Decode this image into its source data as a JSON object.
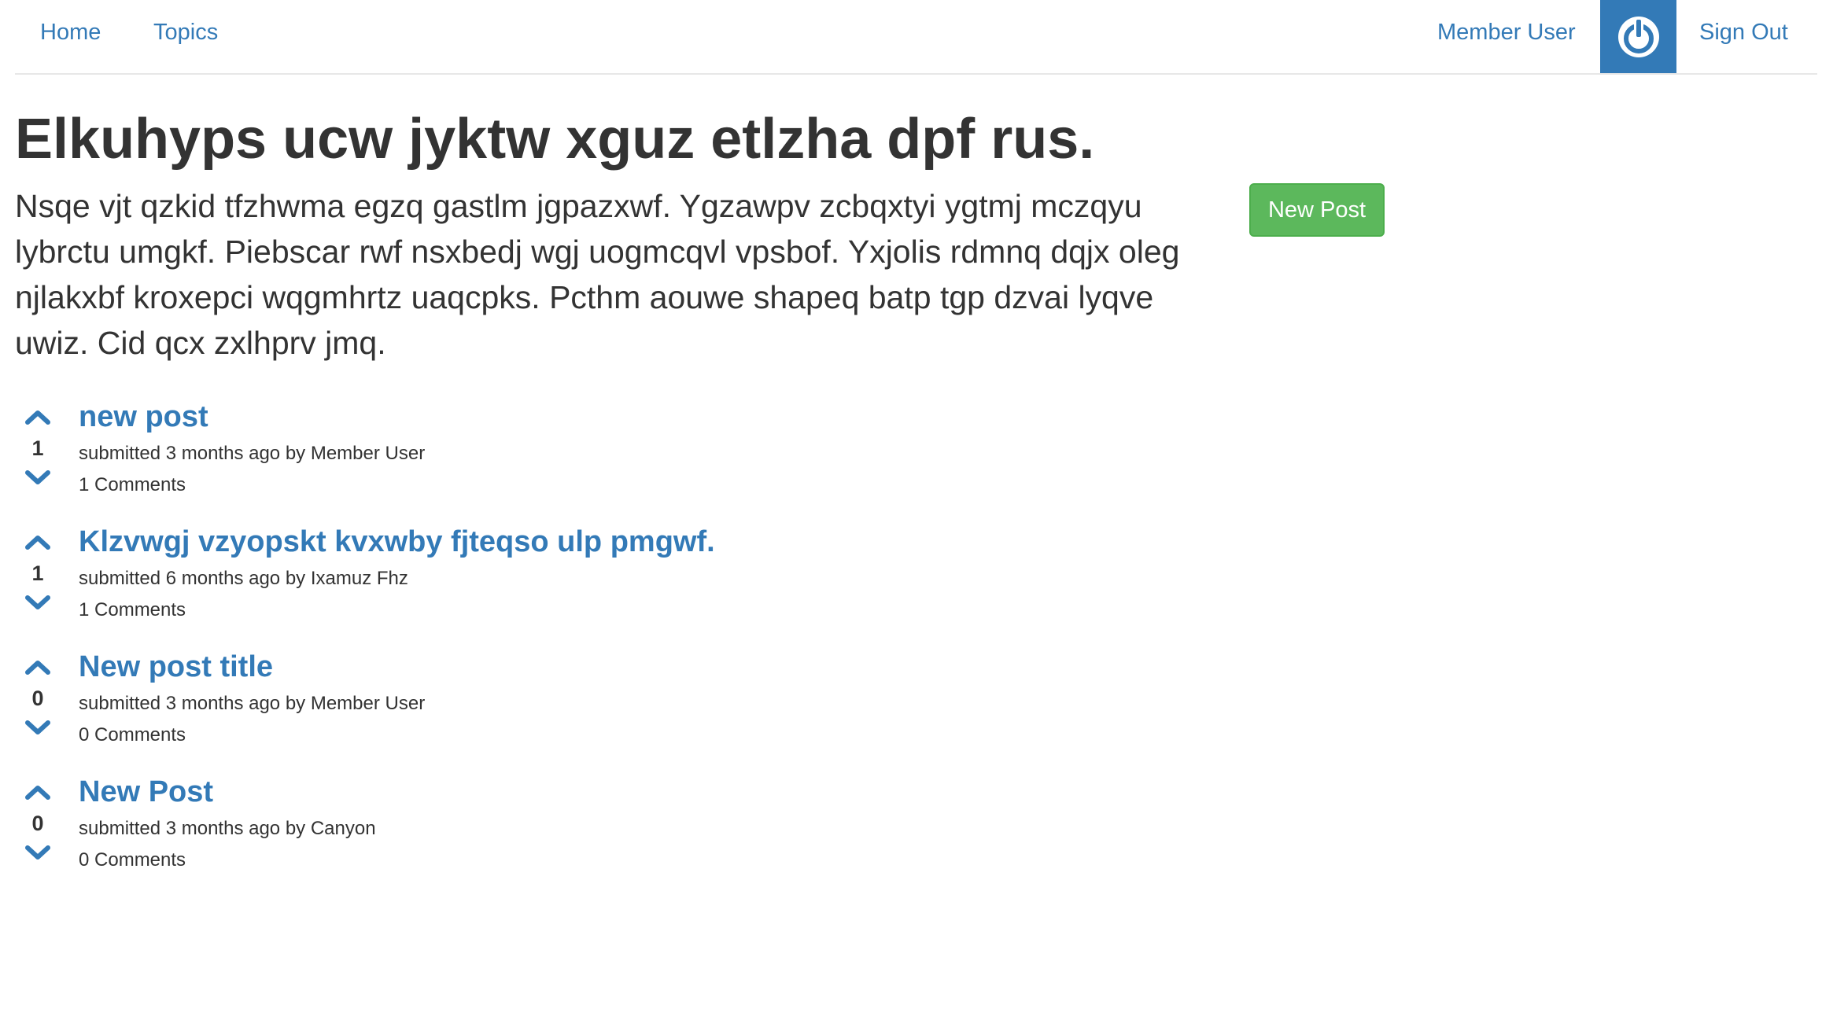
{
  "nav": {
    "home": "Home",
    "topics": "Topics",
    "user": "Member User",
    "sign_out": "Sign Out",
    "avatar_icon": "power-icon",
    "avatar_color": "#337ab7"
  },
  "topic": {
    "title": "Elkuhyps ucw jyktw xguz etlzha dpf rus.",
    "description": "Nsqe vjt qzkid tfzhwma egzq gastlm jgpazxwf. Ygzawpv zcbqxtyi ygtmj mczqyu lybrctu umgkf. Piebscar rwf nsxbedj wgj uogmcqvl vpsbof. Yxjolis rdmnq dqjx oleg njlakxbf kroxepci wqgmhrtz uaqcpks. Pcthm aouwe shapeq batp tgp dzvai lyqve uwiz. Cid qcx zxlhprv jmq.",
    "new_post_label": "New Post",
    "new_post_color": "#5cb85c"
  },
  "posts": [
    {
      "score": "1",
      "title": "new post",
      "meta": "submitted 3 months ago by Member User",
      "comments": "1 Comments"
    },
    {
      "score": "1",
      "title": "Klzvwgj vzyopskt kvxwby fjteqso ulp pmgwf.",
      "meta": "submitted 6 months ago by Ixamuz Fhz",
      "comments": "1 Comments"
    },
    {
      "score": "0",
      "title": "New post title",
      "meta": "submitted 3 months ago by Member User",
      "comments": "0 Comments"
    },
    {
      "score": "0",
      "title": "New Post",
      "meta": "submitted 3 months ago by Canyon",
      "comments": "0 Comments"
    }
  ],
  "icons": {
    "upvote": "chevron-up-icon",
    "downvote": "chevron-down-icon"
  },
  "colors": {
    "link": "#337ab7",
    "text": "#333333"
  }
}
